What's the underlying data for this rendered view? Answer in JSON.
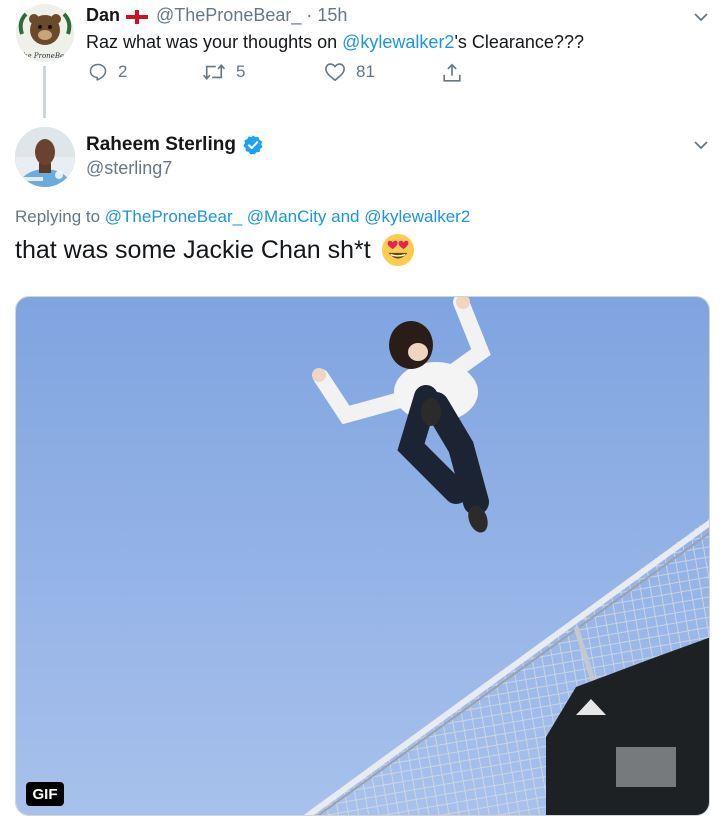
{
  "parent_tweet": {
    "name": "Dan",
    "flag": "england-flag",
    "handle": "@TheProneBear_",
    "separator": "·",
    "time": "15h",
    "text_before": "Raz what was your thoughts on ",
    "mention": "@kylewalker2",
    "text_after": "'s Clearance???",
    "avatar_caption": "The ProneBear",
    "replies": "2",
    "retweets": "5",
    "likes": "81"
  },
  "main_tweet": {
    "name": "Raheem Sterling",
    "handle": "@sterling7",
    "replying_prefix": "Replying to ",
    "reply_mention_1": "@TheProneBear_",
    "reply_mention_2": "@ManCity",
    "reply_and": " and ",
    "reply_mention_3": "@kylewalker2",
    "text": "that was some Jackie Chan sh*t",
    "emoji": "heart-eyes-emoji",
    "media_badge": "GIF"
  },
  "colors": {
    "link": "#1b95e0",
    "muted": "#657786",
    "verified": "#1da1f2",
    "sky": "#8bb0e6"
  }
}
